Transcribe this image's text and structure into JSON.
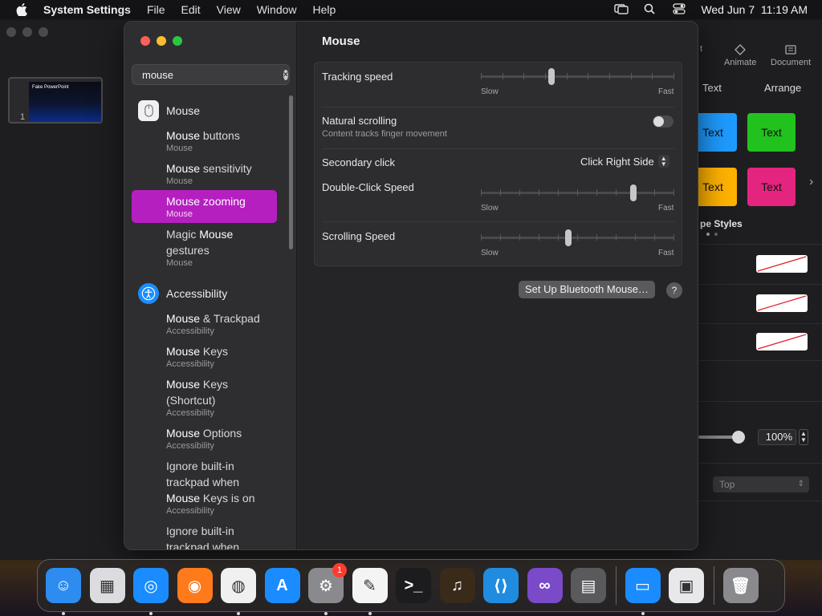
{
  "menubar": {
    "app_name": "System Settings",
    "items": [
      "File",
      "Edit",
      "View",
      "Window",
      "Help"
    ],
    "clock": "Wed Jun 7  11:19 AM"
  },
  "keynote": {
    "slide_number": "1",
    "slide_title": "Fake PowerPoint",
    "toolbar": {
      "animate": "Animate",
      "document": "Document",
      "partial": "t"
    },
    "inspector_tabs": [
      "Text",
      "Arrange"
    ],
    "style_tiles": [
      {
        "label": "Text",
        "color": "#1e9bff"
      },
      {
        "label": "Text",
        "color": "#22c21e"
      },
      {
        "label": "Text",
        "color": "#ffb300"
      },
      {
        "label": "Text",
        "color": "#e4257f"
      }
    ],
    "shape_styles_label": "pe Styles",
    "opacity_value": "100%",
    "align_value": "Top"
  },
  "settings": {
    "search": {
      "value": "mouse",
      "placeholder": "Search"
    },
    "sections": [
      {
        "title": "Mouse",
        "icon": "mouse-icon",
        "items": [
          {
            "title": "Mouse buttons",
            "subtitle": "Mouse",
            "selected": false
          },
          {
            "title": "Mouse sensitivity",
            "subtitle": "Mouse",
            "selected": false
          },
          {
            "title": "Mouse zooming",
            "subtitle": "Mouse",
            "selected": true
          },
          {
            "title": "Magic Mouse gestures",
            "subtitle": "Mouse",
            "selected": false
          }
        ]
      },
      {
        "title": "Accessibility",
        "icon": "accessibility-icon",
        "items": [
          {
            "title": "Mouse & Trackpad",
            "subtitle": "Accessibility",
            "selected": false
          },
          {
            "title": "Mouse Keys",
            "subtitle": "Accessibility",
            "selected": false
          },
          {
            "title": "Mouse Keys (Shortcut)",
            "subtitle": "Accessibility",
            "selected": false
          },
          {
            "title": "Mouse Options",
            "subtitle": "Accessibility",
            "selected": false
          },
          {
            "title": "Ignore built-in trackpad when Mouse Keys is on",
            "subtitle": "Accessibility",
            "selected": false
          },
          {
            "title": "Ignore built-in trackpad when",
            "subtitle": "",
            "selected": false
          }
        ]
      }
    ],
    "pane": {
      "title": "Mouse",
      "tracking_speed": {
        "label": "Tracking speed",
        "min": "Slow",
        "max": "Fast",
        "value": 0.36
      },
      "natural_scrolling": {
        "label": "Natural scrolling",
        "sublabel": "Content tracks finger movement",
        "enabled": false
      },
      "secondary_click": {
        "label": "Secondary click",
        "value": "Click Right Side"
      },
      "double_click_speed": {
        "label": "Double-Click Speed",
        "min": "Slow",
        "max": "Fast",
        "value": 0.8
      },
      "scrolling_speed": {
        "label": "Scrolling Speed",
        "min": "Slow",
        "max": "Fast",
        "value": 0.45
      },
      "bluetooth_button": "Set Up Bluetooth Mouse…",
      "help": "?"
    }
  },
  "dock": {
    "apps": [
      {
        "name": "Finder",
        "icon": "finder-icon",
        "color": "#2d8cf0",
        "running": true
      },
      {
        "name": "Launchpad",
        "icon": "launchpad-icon",
        "color": "#dcdce0",
        "running": false
      },
      {
        "name": "Safari",
        "icon": "safari-icon",
        "color": "#1a8cff",
        "running": true
      },
      {
        "name": "Firefox",
        "icon": "firefox-icon",
        "color": "#ff7a1a",
        "running": false
      },
      {
        "name": "Chrome",
        "icon": "chrome-icon",
        "color": "#f0f0f0",
        "running": true
      },
      {
        "name": "App Store",
        "icon": "app-store-icon",
        "color": "#1a8cff",
        "running": false
      },
      {
        "name": "System Settings",
        "icon": "system-settings-icon",
        "color": "#8a8a8e",
        "running": true,
        "badge": "1"
      },
      {
        "name": "TextEdit",
        "icon": "textedit-icon",
        "color": "#f4f4f4",
        "running": true
      },
      {
        "name": "Terminal",
        "icon": "terminal-icon",
        "color": "#1c1c1e",
        "running": false
      },
      {
        "name": "GarageBand",
        "icon": "garageband-icon",
        "color": "#3a2a1a",
        "running": false
      },
      {
        "name": "Visual Studio Code",
        "icon": "vscode-icon",
        "color": "#1f8ce0",
        "running": false
      },
      {
        "name": "Visual Studio",
        "icon": "visual-studio-icon",
        "color": "#7a4ac8",
        "running": false
      },
      {
        "name": "Calculator",
        "icon": "calculator-icon",
        "color": "#5a5a5c",
        "running": false
      },
      {
        "name": "Keynote",
        "icon": "keynote-icon",
        "color": "#1a8cff",
        "running": true
      },
      {
        "name": "Preview",
        "icon": "preview-icon",
        "color": "#e8e8ea",
        "running": false
      },
      {
        "name": "Trash",
        "icon": "trash-icon",
        "color": "#8a8a8e",
        "running": false
      }
    ]
  }
}
